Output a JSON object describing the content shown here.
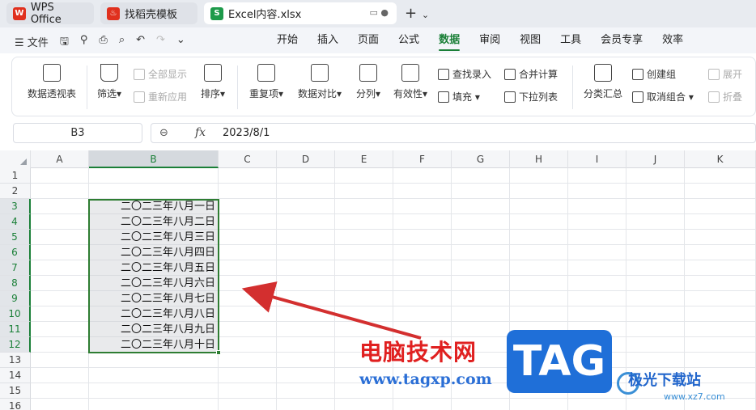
{
  "tabs": [
    {
      "label": "WPS Office",
      "icon": "wps-logo-icon"
    },
    {
      "label": "找稻壳模板",
      "icon": "daoke-icon"
    },
    {
      "label": "Excel内容.xlsx",
      "icon": "spreadsheet-s-icon"
    }
  ],
  "menubar": {
    "file_label": "文件",
    "tabs": [
      "开始",
      "插入",
      "页面",
      "公式",
      "数据",
      "审阅",
      "视图",
      "工具",
      "会员专享",
      "效率"
    ],
    "active": "数据"
  },
  "ribbon": {
    "pivot": "数据透视表",
    "filter": "筛选",
    "show_all": "全部显示",
    "reapply": "重新应用",
    "sort": "排序",
    "duplicates": "重复项",
    "compare": "数据对比",
    "split": "分列",
    "validity": "有效性",
    "lookup_entry": "查找录入",
    "fill": "填充",
    "merge_calc": "合并计算",
    "dropdown_list": "下拉列表",
    "subtotal": "分类汇总",
    "create_group": "创建组",
    "ungroup": "取消组合",
    "expand": "展开",
    "collapse": "折叠"
  },
  "formula_bar": {
    "name_box": "B3",
    "fx": "fx",
    "value": "2023/8/1"
  },
  "sheet": {
    "columns": [
      "A",
      "B",
      "C",
      "D",
      "E",
      "F",
      "G",
      "H",
      "I",
      "J",
      "K"
    ],
    "rows": [
      "1",
      "2",
      "3",
      "4",
      "5",
      "6",
      "7",
      "8",
      "9",
      "10",
      "11",
      "12",
      "13",
      "14",
      "15",
      "16"
    ],
    "selected_column": "B",
    "cells_b": [
      "二〇二三年八月一日",
      "二〇二三年八月二日",
      "二〇二三年八月三日",
      "二〇二三年八月四日",
      "二〇二三年八月五日",
      "二〇二三年八月六日",
      "二〇二三年八月七日",
      "二〇二三年八月八日",
      "二〇二三年八月九日",
      "二〇二三年八月十日"
    ]
  },
  "watermark": {
    "site_cn": "电脑技术网",
    "site_url": "www.tagxp.com",
    "tag": "TAG",
    "jg_name": "极光下载站",
    "jg_url": "www.xz7.com"
  },
  "colors": {
    "accent": "#1a7f37",
    "selection_border": "#2e7d32",
    "arrow": "#d32f2f"
  }
}
